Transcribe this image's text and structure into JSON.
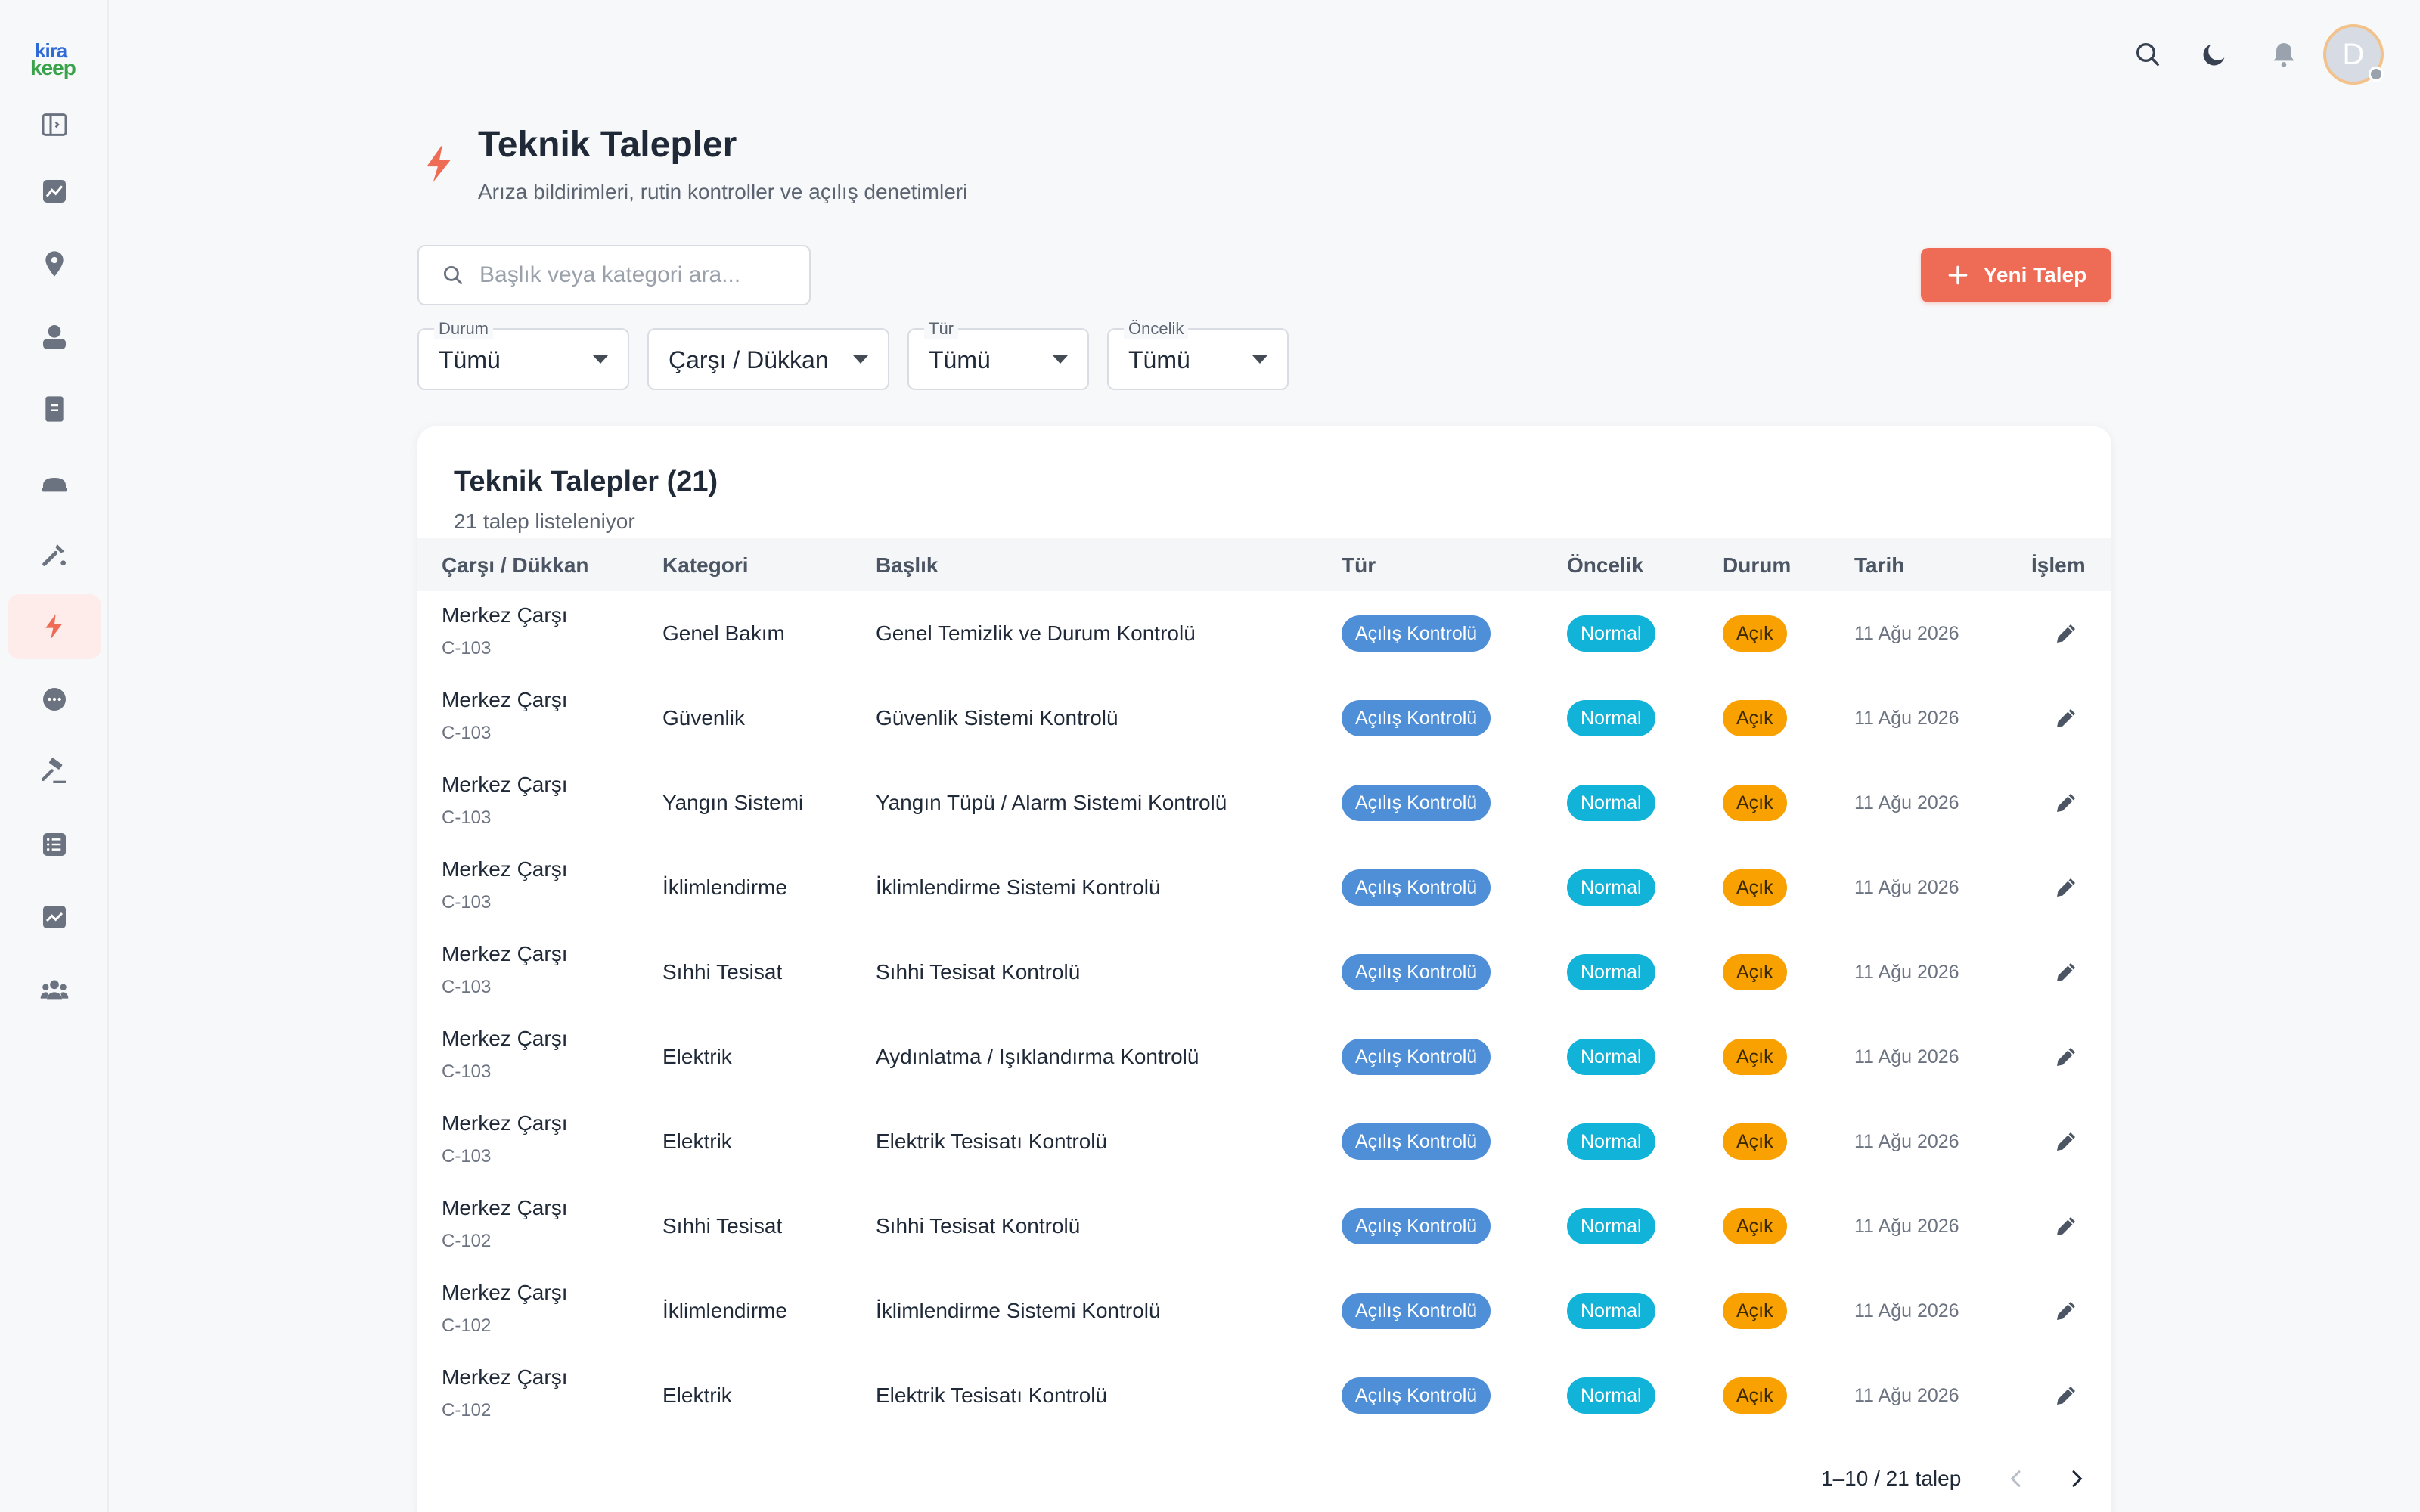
{
  "brand": {
    "logo_line1": "kira",
    "logo_line2": "keep"
  },
  "sidebar": {
    "items": [
      {
        "icon": "sidebar-toggle-icon"
      },
      {
        "icon": "chart-icon"
      },
      {
        "icon": "location-pin-icon"
      },
      {
        "icon": "person-icon"
      },
      {
        "icon": "document-icon"
      },
      {
        "icon": "car-icon"
      },
      {
        "icon": "tools-icon"
      },
      {
        "icon": "bolt-icon",
        "active": true
      },
      {
        "icon": "chat-icon"
      },
      {
        "icon": "gavel-icon"
      },
      {
        "icon": "list-icon"
      },
      {
        "icon": "trend-icon"
      },
      {
        "icon": "people-icon"
      }
    ]
  },
  "topbar": {
    "avatar_letter": "D"
  },
  "header": {
    "title": "Teknik Talepler",
    "subtitle": "Arıza bildirimleri, rutin kontroller ve açılış denetimleri"
  },
  "search": {
    "placeholder": "Başlık veya kategori ara..."
  },
  "actions": {
    "new_label": "Yeni Talep"
  },
  "filters": [
    {
      "label": "Durum",
      "value": "Tümü"
    },
    {
      "label": "",
      "value": "Çarşı / Dükkan"
    },
    {
      "label": "Tür",
      "value": "Tümü"
    },
    {
      "label": "Öncelik",
      "value": "Tümü"
    }
  ],
  "card": {
    "title": "Teknik Talepler (21)",
    "subtitle": "21 talep listeleniyor"
  },
  "table": {
    "columns": [
      "Çarşı / Dükkan",
      "Kategori",
      "Başlık",
      "Tür",
      "Öncelik",
      "Durum",
      "Tarih",
      "İşlem"
    ],
    "rows": [
      {
        "carsi": "Merkez Çarşı",
        "dukkan": "C-103",
        "kategori": "Genel Bakım",
        "baslik": "Genel Temizlik ve Durum Kontrolü",
        "tur": "Açılış Kontrolü",
        "oncelik": "Normal",
        "durum": "Açık",
        "tarih": "11 Ağu 2026"
      },
      {
        "carsi": "Merkez Çarşı",
        "dukkan": "C-103",
        "kategori": "Güvenlik",
        "baslik": "Güvenlik Sistemi Kontrolü",
        "tur": "Açılış Kontrolü",
        "oncelik": "Normal",
        "durum": "Açık",
        "tarih": "11 Ağu 2026"
      },
      {
        "carsi": "Merkez Çarşı",
        "dukkan": "C-103",
        "kategori": "Yangın Sistemi",
        "baslik": "Yangın Tüpü / Alarm Sistemi Kontrolü",
        "tur": "Açılış Kontrolü",
        "oncelik": "Normal",
        "durum": "Açık",
        "tarih": "11 Ağu 2026"
      },
      {
        "carsi": "Merkez Çarşı",
        "dukkan": "C-103",
        "kategori": "İklimlendirme",
        "baslik": "İklimlendirme Sistemi Kontrolü",
        "tur": "Açılış Kontrolü",
        "oncelik": "Normal",
        "durum": "Açık",
        "tarih": "11 Ağu 2026"
      },
      {
        "carsi": "Merkez Çarşı",
        "dukkan": "C-103",
        "kategori": "Sıhhi Tesisat",
        "baslik": "Sıhhi Tesisat Kontrolü",
        "tur": "Açılış Kontrolü",
        "oncelik": "Normal",
        "durum": "Açık",
        "tarih": "11 Ağu 2026"
      },
      {
        "carsi": "Merkez Çarşı",
        "dukkan": "C-103",
        "kategori": "Elektrik",
        "baslik": "Aydınlatma / Işıklandırma Kontrolü",
        "tur": "Açılış Kontrolü",
        "oncelik": "Normal",
        "durum": "Açık",
        "tarih": "11 Ağu 2026"
      },
      {
        "carsi": "Merkez Çarşı",
        "dukkan": "C-103",
        "kategori": "Elektrik",
        "baslik": "Elektrik Tesisatı Kontrolü",
        "tur": "Açılış Kontrolü",
        "oncelik": "Normal",
        "durum": "Açık",
        "tarih": "11 Ağu 2026"
      },
      {
        "carsi": "Merkez Çarşı",
        "dukkan": "C-102",
        "kategori": "Sıhhi Tesisat",
        "baslik": "Sıhhi Tesisat Kontrolü",
        "tur": "Açılış Kontrolü",
        "oncelik": "Normal",
        "durum": "Açık",
        "tarih": "11 Ağu 2026"
      },
      {
        "carsi": "Merkez Çarşı",
        "dukkan": "C-102",
        "kategori": "İklimlendirme",
        "baslik": "İklimlendirme Sistemi Kontrolü",
        "tur": "Açılış Kontrolü",
        "oncelik": "Normal",
        "durum": "Açık",
        "tarih": "11 Ağu 2026"
      },
      {
        "carsi": "Merkez Çarşı",
        "dukkan": "C-102",
        "kategori": "Elektrik",
        "baslik": "Elektrik Tesisatı Kontrolü",
        "tur": "Açılış Kontrolü",
        "oncelik": "Normal",
        "durum": "Açık",
        "tarih": "11 Ağu 2026"
      }
    ]
  },
  "pagination": {
    "label": "1–10 / 21 talep"
  },
  "colors": {
    "accent": "#ee6b55",
    "chip_tur": "#4f8fd8",
    "chip_oncelik": "#12b3d8",
    "chip_durum": "#f8a100"
  }
}
